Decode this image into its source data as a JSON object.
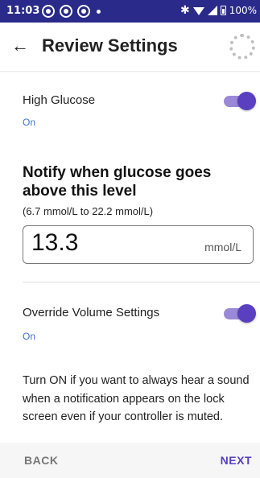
{
  "status_bar": {
    "time": "11:03",
    "battery": "100%",
    "icons": [
      "notification-icon",
      "notification-icon",
      "notification-icon",
      "dot-icon",
      "bluetooth-icon",
      "wifi-icon",
      "signal-icon",
      "battery-icon"
    ]
  },
  "header": {
    "title": "Review Settings",
    "back_icon": "arrow-left-icon",
    "spinner_icon": "loading-spinner-icon"
  },
  "high_glucose": {
    "label": "High Glucose",
    "state": "On",
    "toggle_on": true
  },
  "notify": {
    "heading": "Notify when glucose goes above this level",
    "range": "(6.7 mmol/L to 22.2 mmol/L)",
    "value": "13.3",
    "unit": "mmol/L"
  },
  "override_volume": {
    "label": "Override Volume Settings",
    "state": "On",
    "toggle_on": true,
    "description": "Turn ON if you want to always hear a sound when a notification appears on the lock screen even if your controller is muted."
  },
  "footer": {
    "back_label": "BACK",
    "next_label": "NEXT"
  },
  "colors": {
    "status_bar": "#2a2a8a",
    "accent": "#5a3fc0",
    "toggle_track": "#9a89d6",
    "link_blue": "#3b73c9"
  }
}
